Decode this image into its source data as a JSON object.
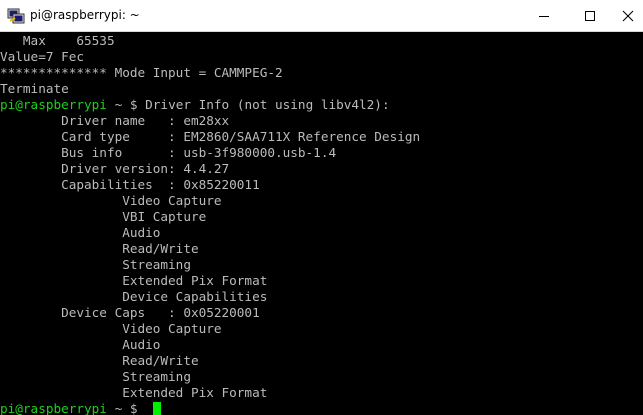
{
  "window": {
    "title": "pi@raspberrypi: ~",
    "icons": {
      "app": "putty-icon",
      "minimize": "minimize-icon",
      "maximize": "maximize-icon",
      "close": "close-icon"
    }
  },
  "colors": {
    "background": "#000000",
    "text": "#bbbbbb",
    "prompt": "#1bd11b",
    "cursor": "#00ee00"
  },
  "terminal": {
    "lines": [
      {
        "text": "   Max    65535"
      },
      {
        "text": "Value=7 Fec"
      },
      {
        "text": "************** Mode Input = CAMMPEG-2"
      },
      {
        "text": "Terminate"
      },
      {
        "prompt": "pi@raspberrypi",
        "path": " ~ $ ",
        "text": "Driver Info (not using libv4l2):"
      },
      {
        "text": "        Driver name   : em28xx"
      },
      {
        "text": "        Card type     : EM2860/SAA711X Reference Design"
      },
      {
        "text": "        Bus info      : usb-3f980000.usb-1.4"
      },
      {
        "text": "        Driver version: 4.4.27"
      },
      {
        "text": "        Capabilities  : 0x85220011"
      },
      {
        "text": "                Video Capture"
      },
      {
        "text": "                VBI Capture"
      },
      {
        "text": "                Audio"
      },
      {
        "text": "                Read/Write"
      },
      {
        "text": "                Streaming"
      },
      {
        "text": "                Extended Pix Format"
      },
      {
        "text": "                Device Capabilities"
      },
      {
        "text": "        Device Caps   : 0x05220001"
      },
      {
        "text": "                Video Capture"
      },
      {
        "text": "                Audio"
      },
      {
        "text": "                Read/Write"
      },
      {
        "text": "                Streaming"
      },
      {
        "text": "                Extended Pix Format"
      },
      {
        "prompt": "pi@raspberrypi",
        "path": " ~ $ ",
        "text": ""
      }
    ]
  }
}
